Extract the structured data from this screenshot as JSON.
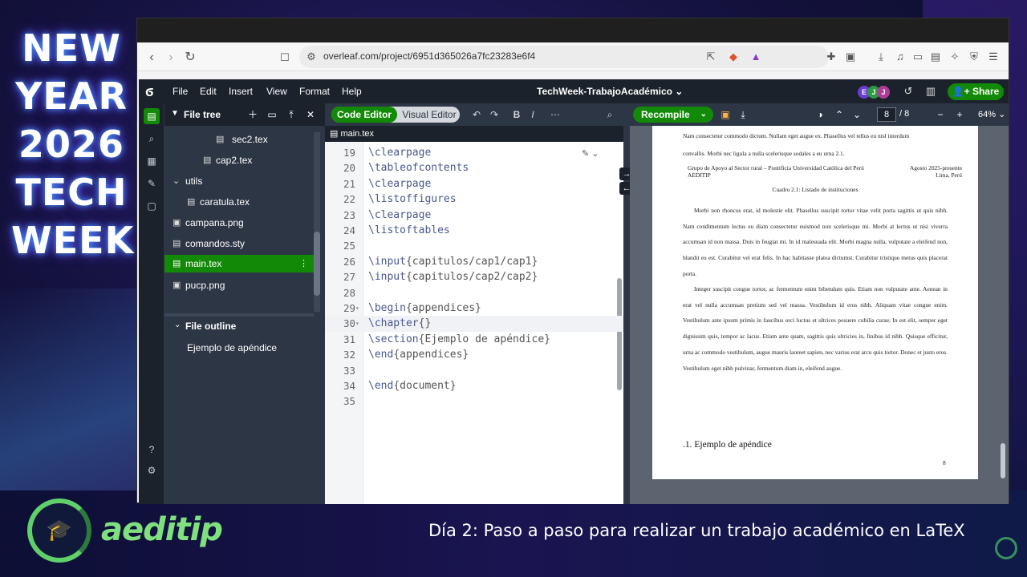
{
  "event": {
    "title_lines": [
      "NEW",
      "YEAR",
      "2026",
      "TECH",
      "WEEK"
    ],
    "brand": "aeditip",
    "subtitle": "Día 2: Paso a paso para realizar un trabajo académico en LaTeX"
  },
  "browser": {
    "url": "overleaf.com/project/6951d365026a7fc23283e6f4"
  },
  "overleaf": {
    "menu": [
      "File",
      "Edit",
      "Insert",
      "View",
      "Format",
      "Help"
    ],
    "project_title": "TechWeek-TrabajoAcadémico ⌄",
    "avatars": [
      "E",
      "J",
      "J"
    ],
    "share_label": "Share",
    "file_tree": {
      "title": "File tree",
      "rows": [
        {
          "label": "sec2.tex",
          "type": "file"
        },
        {
          "label": "cap2.tex",
          "type": "file"
        },
        {
          "label": "utils",
          "type": "folder"
        },
        {
          "label": "caratula.tex",
          "type": "file"
        },
        {
          "label": "campana.png",
          "type": "image"
        },
        {
          "label": "comandos.sty",
          "type": "file"
        },
        {
          "label": "main.tex",
          "type": "file",
          "selected": true
        },
        {
          "label": "pucp.png",
          "type": "image"
        }
      ]
    },
    "outline": {
      "title": "File outline",
      "items": [
        "Ejemplo de apéndice"
      ]
    },
    "editor": {
      "mode_code": "Code Editor",
      "mode_visual": "Visual Editor",
      "open_file": "main.tex",
      "lines": [
        {
          "n": "19",
          "cmd": "\\clearpage",
          "arg": ""
        },
        {
          "n": "20",
          "cmd": "\\tableofcontents",
          "arg": ""
        },
        {
          "n": "21",
          "cmd": "\\clearpage",
          "arg": ""
        },
        {
          "n": "22",
          "cmd": "\\listoffigures",
          "arg": ""
        },
        {
          "n": "23",
          "cmd": "\\clearpage",
          "arg": ""
        },
        {
          "n": "24",
          "cmd": "\\listoftables",
          "arg": ""
        },
        {
          "n": "25",
          "cmd": "",
          "arg": ""
        },
        {
          "n": "26",
          "cmd": "\\input",
          "arg": "{capitulos/cap1/cap1}"
        },
        {
          "n": "27",
          "cmd": "\\input",
          "arg": "{capitulos/cap2/cap2}"
        },
        {
          "n": "28",
          "cmd": "",
          "arg": ""
        },
        {
          "n": "29",
          "cmd": "\\begin",
          "arg": "{appendices}"
        },
        {
          "n": "30",
          "cmd": "\\chapter",
          "arg": "{}"
        },
        {
          "n": "31",
          "cmd": "\\section",
          "arg": "{Ejemplo de apéndice}"
        },
        {
          "n": "32",
          "cmd": "\\end",
          "arg": "{appendices}"
        },
        {
          "n": "33",
          "cmd": "",
          "arg": ""
        },
        {
          "n": "34",
          "cmd": "\\end",
          "arg": "{document}"
        },
        {
          "n": "35",
          "cmd": "",
          "arg": ""
        }
      ]
    },
    "pdf": {
      "recompile_label": "Recompile",
      "page_current": "8",
      "page_total": "/ 8",
      "zoom": "64%",
      "lines_top": [
        "Nam consectetur commodo dictum. Nullam eget augue ex. Phasellus vel tellus eu nisl interdum",
        "convallis. Morbi nec ligula a nulla scelerisque sodales a eu urna 2.1."
      ],
      "table_row_left": "Grupo de Apoyo al Sector rural – Pontificia Universidad Católica del Perú",
      "table_row_left2": "AEDITIP",
      "table_row_right": "Agosto 2025-presente",
      "table_row_right2": "Lima, Perú",
      "caption": "Cuadro 2.1: Listado de instituciones",
      "para1": "Morbi non rhoncus erat, id molestie elit. Phasellus suscipit tortor vitae velit porta sagittis ut quis nibh. Nam condimentum lectus eu diam consectetur euismod non scelerisque mi. Morbi at lectus ut nisi viverra accumsan id non massa. Duis in feugiat mi. In id malesuada elit. Morbi magna nulla, vulputate a eleifend non, blandit eu est. Curabitur vel erat felis. In hac habitasse platea dictumst. Curabitur tristique metus quis placerat porta.",
      "para2": "Integer suscipit congue tortor, ac fermentum enim bibendum quis. Etiam non vulputate ante. Aenean in erat vel nulla accumsan pretium sed vel massa. Vestibulum id eros nibh. Aliquam vitae congue enim. Vestibulum ante ipsum primis in faucibus orci luctus et ultrices posuere cubilia curae; In est elit, semper eget dignissim quis, tempor ac lacus. Etiam ante quam, sagittis quis ultricies in, finibus id nibh. Quisque efficitur, urna ac commodo vestibulum, augue mauris laoreet sapien, nec varius erat arcu quis tortor. Donec et justo eros. Vestibulum eget nibh pulvinar, fermentum diam in, eleifend augue.",
      "heading": ".1.    Ejemplo de apéndice",
      "page_number": "8"
    }
  },
  "colors": {
    "overleaf_green": "#138a07",
    "overleaf_dark": "#1b222c",
    "panel": "#2c3645",
    "brand_green": "#7fe07d"
  }
}
